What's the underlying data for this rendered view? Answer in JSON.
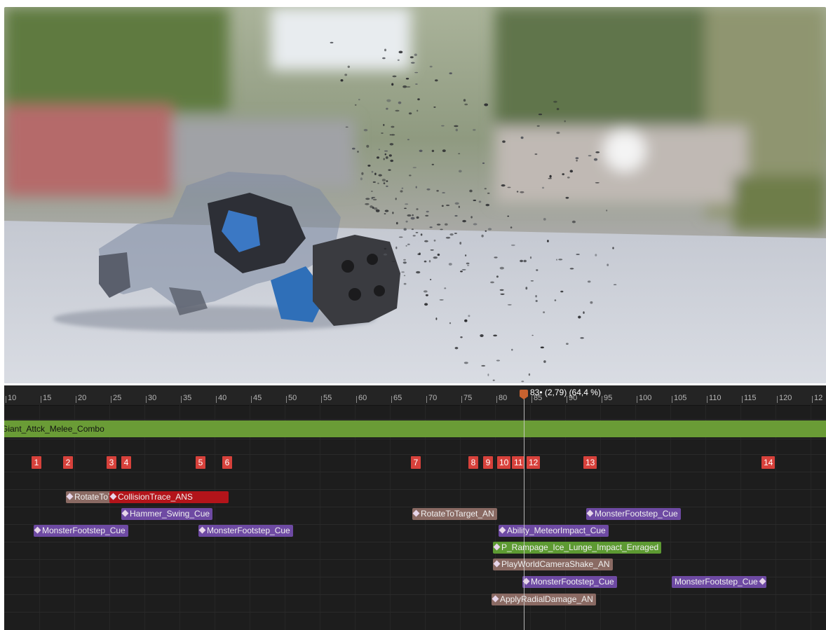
{
  "ruler": {
    "ticks": [
      "10",
      "15",
      "20",
      "25",
      "30",
      "35",
      "40",
      "45",
      "50",
      "55",
      "60",
      "65",
      "70",
      "75",
      "80",
      "85",
      "90",
      "95",
      "100",
      "105",
      "110",
      "115",
      "120",
      "12"
    ],
    "playhead_readout": "83• (2,79) (64,4 %)"
  },
  "montage": {
    "slot_label": "Giant_Attck_Melee_Combo"
  },
  "sections": [
    "1",
    "2",
    "3",
    "4",
    "5",
    "6",
    "7",
    "8",
    "9",
    "10",
    "11",
    "12",
    "13",
    "14"
  ],
  "notifies": {
    "rotate_to_target_1": "RotateToTarget_AN",
    "collision_trace": "CollisionTrace_ANS",
    "hammer_swing": "Hammer_Swing_Cue",
    "footstep_1": "MonsterFootstep_Cue",
    "footstep_2": "MonsterFootstep_Cue",
    "rotate_to_target_2": "RotateToTarget_AN",
    "footstep_3": "MonsterFootstep_Cue",
    "meteor_impact": "Ability_MeteorImpact_Cue",
    "lunge_impact": "P_Rampage_Ice_Lunge_Impact_Enraged",
    "camera_shake": "PlayWorldCameraShake_AN",
    "footstep_4": "MonsterFootstep_Cue",
    "footstep_5": "MonsterFootstep_Cue",
    "radial_damage": "ApplyRadialDamage_AN"
  },
  "colors": {
    "montage_track": "#6a9c36",
    "section_marker": "#d7413b",
    "notify_purple": "#6e4aa3",
    "notify_tan": "#8a6a63",
    "notify_red": "#b3141a",
    "notify_green": "#5d9a32",
    "playhead": "#c8622f"
  }
}
